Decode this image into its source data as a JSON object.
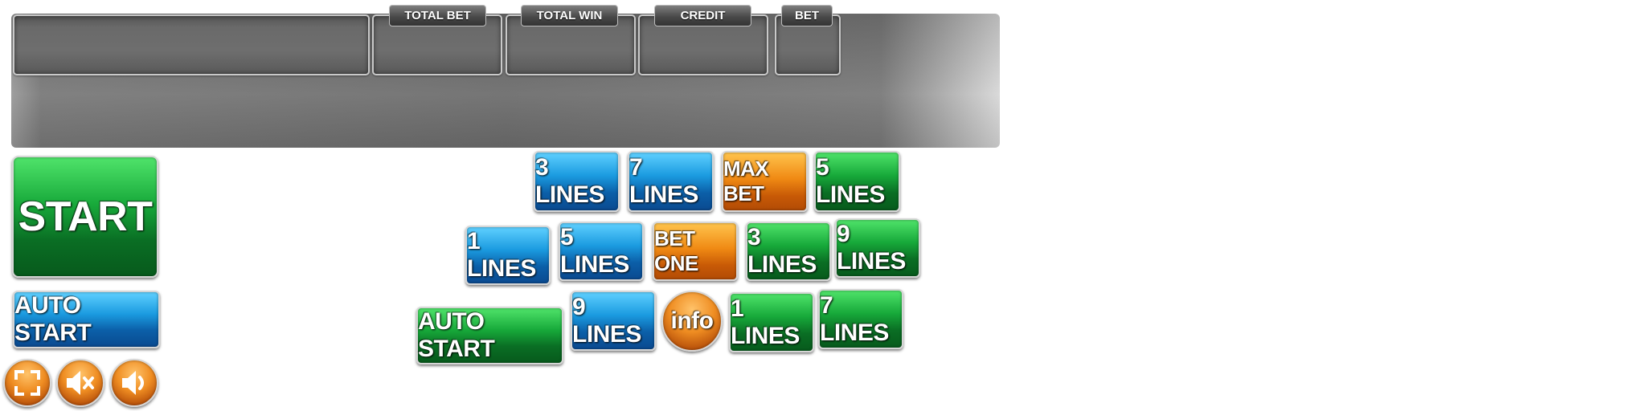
{
  "header": {
    "labels": {
      "total_bet": "TOTAL BET",
      "total_win": "TOTAL WIN",
      "credit": "CREDIT",
      "bet": "BET"
    }
  },
  "controls": {
    "start": "START",
    "auto_start": "AUTO START",
    "auto_start_alt": "AUTO START",
    "icons": [
      "fullscreen-icon",
      "mute-icon",
      "speaker-icon"
    ]
  },
  "buttons": {
    "row1": [
      "3 LINES",
      "7 LINES",
      "MAX BET",
      "5 LINES"
    ],
    "row2": [
      "1 LINES",
      "5 LINES",
      "BET ONE",
      "3 LINES",
      "9 LINES"
    ],
    "row3": [
      "9 LINES",
      "info",
      "1 LINES",
      "7 LINES"
    ]
  },
  "colors": {
    "blue": "#1b9be0",
    "green": "#17a93a",
    "orange": "#f08a14",
    "panel_gray": "#6e6e6e"
  }
}
